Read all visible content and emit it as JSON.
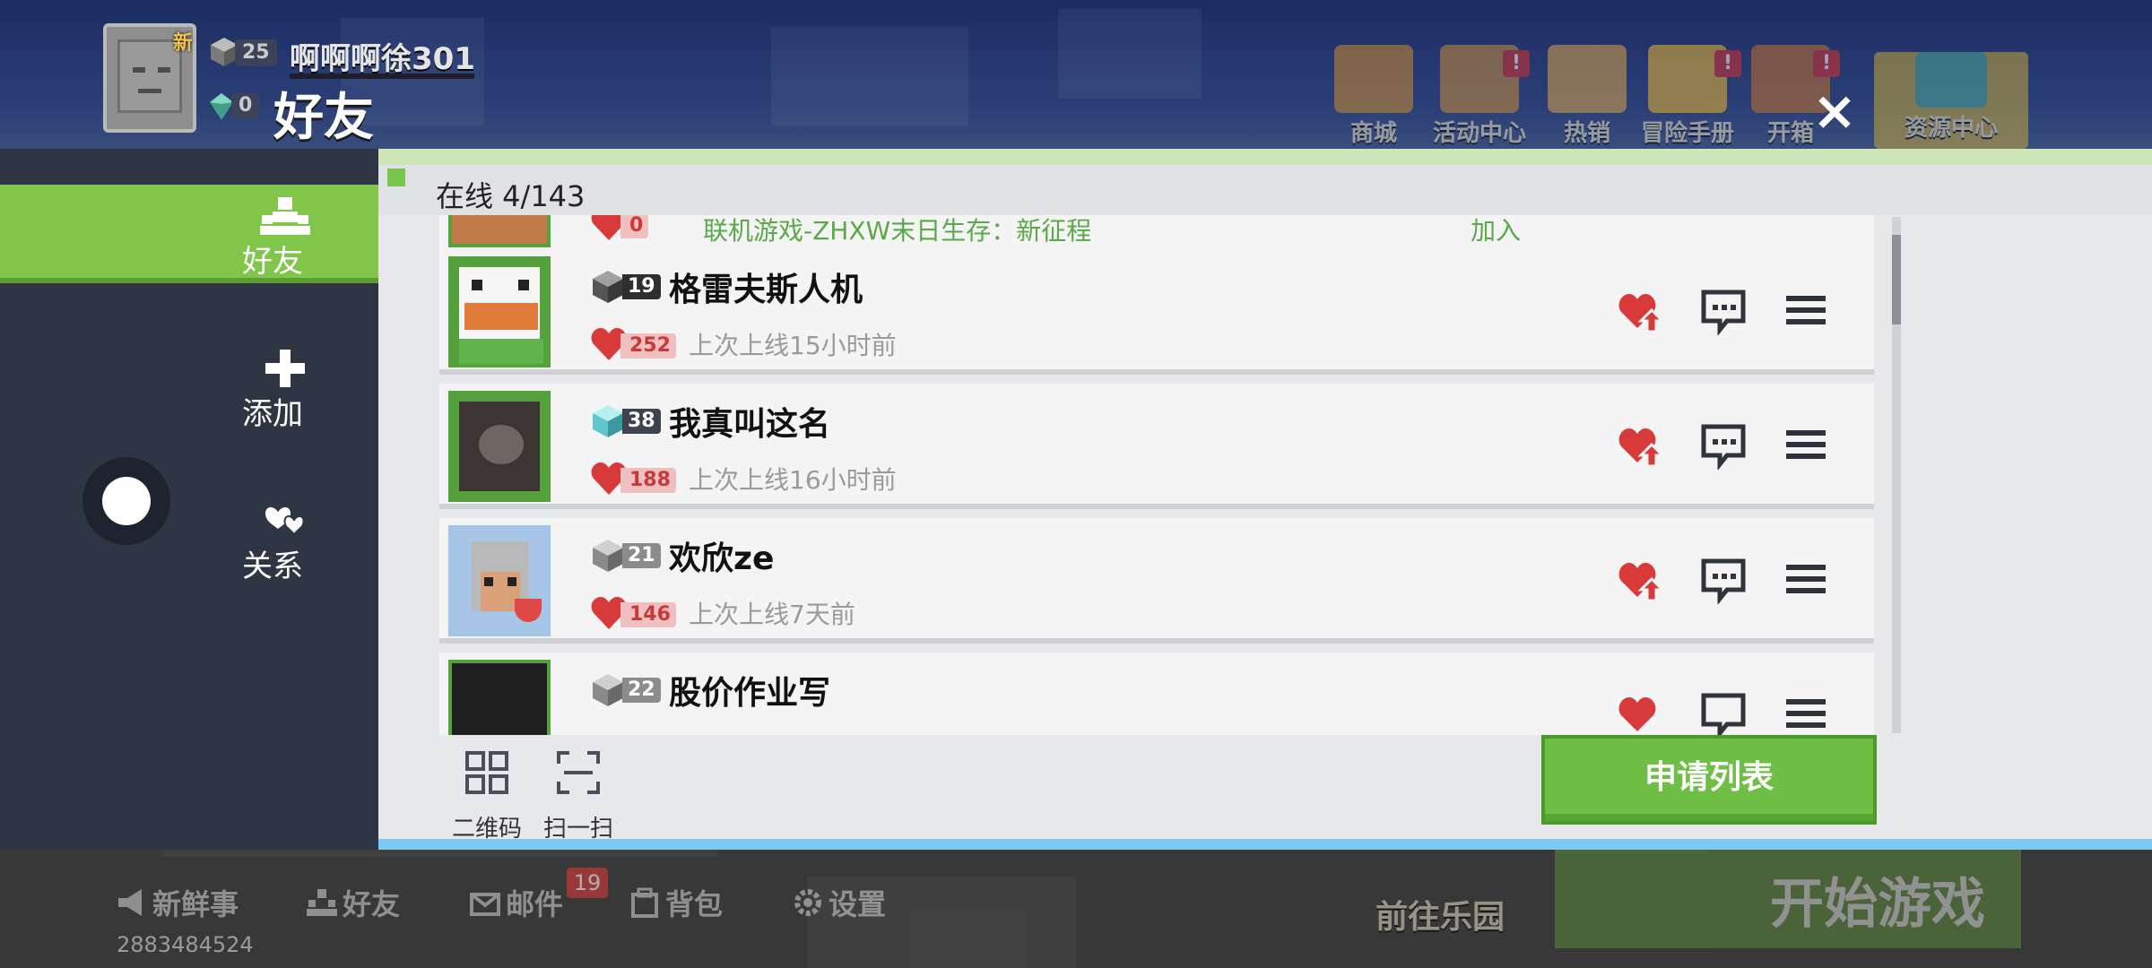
{
  "profile": {
    "new_tag": "新",
    "level": "25",
    "username": "啊啊啊徐301",
    "gems": "0"
  },
  "header": {
    "title": "好友"
  },
  "top_menu": [
    {
      "label": "商城",
      "badge": ""
    },
    {
      "label": "活动中心",
      "badge": "!"
    },
    {
      "label": "热销",
      "badge": ""
    },
    {
      "label": "冒险手册",
      "badge": "!"
    },
    {
      "label": "开箱",
      "badge": "!"
    },
    {
      "label": "资源中心",
      "badge": ""
    }
  ],
  "close_icon": "×",
  "sidebar": {
    "items": [
      {
        "label": "好友",
        "icon": "friends-icon",
        "active": true
      },
      {
        "label": "添加",
        "icon": "plus-icon",
        "active": false
      },
      {
        "label": "关系",
        "icon": "hearts-icon",
        "active": false
      }
    ]
  },
  "online": {
    "text": "在线 4/143"
  },
  "partial_row": {
    "hearts": "0",
    "status": "联机游戏-ZHXW末日生存：新征程",
    "join": "加入"
  },
  "friends": [
    {
      "name": "格雷夫斯人机",
      "level": "19",
      "hearts": "252",
      "last_online": "上次上线15小时前"
    },
    {
      "name": "我真叫这名",
      "level": "38",
      "hearts": "188",
      "last_online": "上次上线16小时前"
    },
    {
      "name": "欢欣ze",
      "level": "21",
      "hearts": "146",
      "last_online": "上次上线7天前"
    },
    {
      "name": "股价作业写",
      "level": "22",
      "hearts": "",
      "last_online": ""
    }
  ],
  "tools": {
    "qrcode_label": "二维码",
    "scan_label": "扫一扫"
  },
  "apply_button": "申请列表",
  "bottom_nav": {
    "items": [
      {
        "label": "新鲜事",
        "icon": "megaphone-icon"
      },
      {
        "label": "好友",
        "icon": "friends-icon"
      },
      {
        "label": "邮件",
        "icon": "mail-icon"
      },
      {
        "label": "背包",
        "icon": "backpack-icon"
      },
      {
        "label": "设置",
        "icon": "gear-icon"
      }
    ],
    "mail_badge": "19",
    "uid": "2883484524",
    "go_park": "前往乐园",
    "start_game": "开始游戏"
  },
  "colors": {
    "accent_green": "#7fc64b",
    "heart_red": "#d83a3a",
    "sidebar_bg": "#2e3543"
  }
}
